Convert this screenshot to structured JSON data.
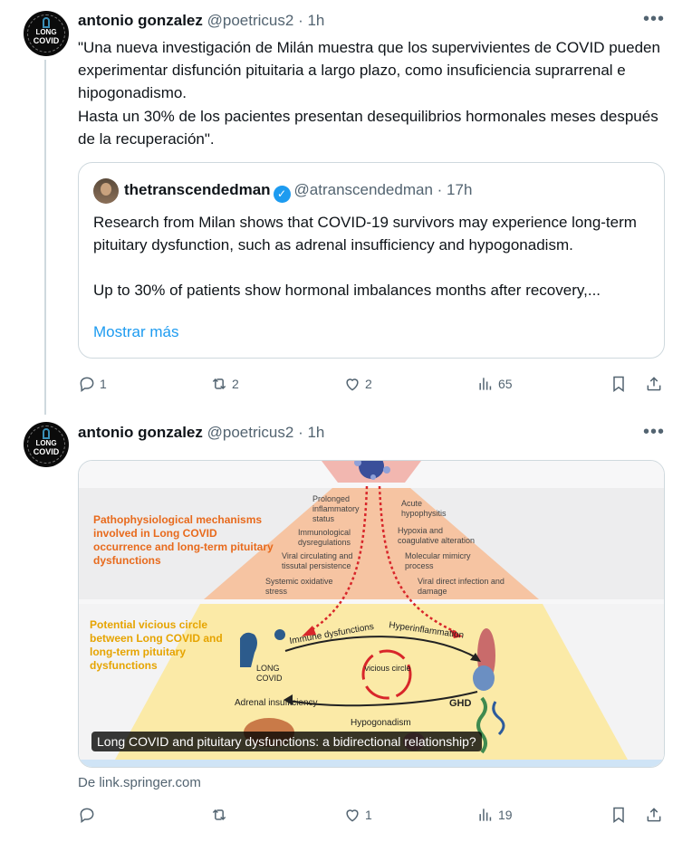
{
  "tweet1": {
    "author": "antonio gonzalez",
    "handle": "@poetricus2",
    "time": "1h",
    "more": "•••",
    "text_lines": [
      "\"Una nueva investigación de Milán muestra que los supervivientes de COVID pueden experimentar disfunción pituitaria a largo plazo, como insuficiencia suprarrenal e hipogonadismo.",
      "Hasta un 30% de los pacientes presentan desequilibrios hormonales meses después de la recuperación\"."
    ],
    "quote": {
      "author": "thetranscendedman",
      "verified": "✓",
      "handle": "@atranscendedman",
      "time": "17h",
      "paragraph1": "Research from Milan shows that COVID-19 survivors may experience long-term pituitary dysfunction, such as adrenal insufficiency and hypogonadism.",
      "paragraph2": "Up to 30% of patients show hormonal imbalances months after recovery,...",
      "show_more": "Mostrar más"
    },
    "actions": {
      "replies": "1",
      "reposts": "2",
      "likes": "2",
      "views": "65"
    }
  },
  "tweet2": {
    "author": "antonio gonzalez",
    "handle": "@poetricus2",
    "time": "1h",
    "more": "•••",
    "figure": {
      "heading1": "Pathophysiological mechanisms involved in Long COVID occurrence and long-term pituitary dysfunctions",
      "heading2": "Potential vicious circle between Long COVID and long-term pituitary dysfunctions",
      "left_mechanisms": [
        "Prolonged inflammatory status",
        "Immunological dysregulations",
        "Viral circulating and tissutal persistence",
        "Systemic oxidative stress"
      ],
      "right_mechanisms": [
        "Acute hypophysitis",
        "Hypoxia and coagulative alteration",
        "Molecular mimicry process",
        "Viral direct infection and damage"
      ],
      "immune": "Immune dysfunctions",
      "hyper": "Hyperinflammation",
      "vicious": "vicious circle",
      "long_covid": "LONG COVID",
      "adrenal": "Adrenal insufficiency",
      "hypogonadism": "Hypogonadism",
      "ghd": "GHD"
    },
    "caption": "Long COVID and pituitary dysfunctions: a bidirectional relationship?",
    "source": "De link.springer.com",
    "actions": {
      "replies": "",
      "reposts": "",
      "likes": "1",
      "views": "19"
    }
  },
  "avatar_text": {
    "line1": "LONG",
    "line2": "COVID"
  },
  "colors": {
    "accent": "#1d9bf0",
    "muted": "#536471",
    "border": "#cfd9de",
    "fig_orange": "#e86a1c",
    "fig_red": "#d8262a"
  }
}
